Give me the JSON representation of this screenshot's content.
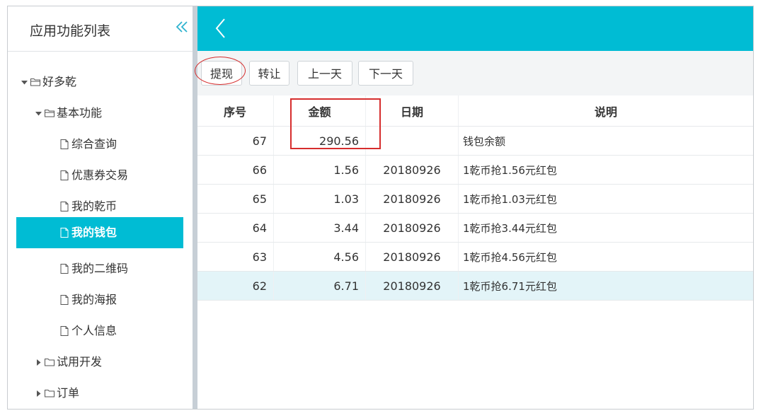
{
  "sidebar": {
    "title": "应用功能列表",
    "collapse_icon": "double-chevron-left-icon",
    "tree": [
      {
        "label": "好多乾",
        "level": 0,
        "type": "folder",
        "expanded": true
      },
      {
        "label": "基本功能",
        "level": 1,
        "type": "folder",
        "expanded": true
      },
      {
        "label": "综合查询",
        "level": 2,
        "type": "file"
      },
      {
        "label": "优惠券交易",
        "level": 2,
        "type": "file"
      },
      {
        "label": "我的乾币",
        "level": 2,
        "type": "file"
      },
      {
        "label": "我的钱包",
        "level": 2,
        "type": "file",
        "active": true
      },
      {
        "label": "我的二维码",
        "level": 2,
        "type": "file"
      },
      {
        "label": "我的海报",
        "level": 2,
        "type": "file"
      },
      {
        "label": "个人信息",
        "level": 2,
        "type": "file"
      },
      {
        "label": "试用开发",
        "level": 1,
        "type": "folder",
        "expanded": false
      },
      {
        "label": "订单",
        "level": 1,
        "type": "folder",
        "expanded": false
      }
    ]
  },
  "topbar": {
    "back_icon": "chevron-left-icon",
    "color": "#00bcd4"
  },
  "toolbar": {
    "withdraw": "提现",
    "transfer": "转让",
    "prev_day": "上一天",
    "next_day": "下一天"
  },
  "table": {
    "columns": [
      "序号",
      "金额",
      "日期",
      "说明"
    ],
    "rows": [
      {
        "no": "67",
        "amount": "290.56",
        "date": "",
        "desc": "钱包余额"
      },
      {
        "no": "66",
        "amount": "1.56",
        "date": "20180926",
        "desc": "1乾币抢1.56元红包"
      },
      {
        "no": "65",
        "amount": "1.03",
        "date": "20180926",
        "desc": "1乾币抢1.03元红包"
      },
      {
        "no": "64",
        "amount": "3.44",
        "date": "20180926",
        "desc": "1乾币抢3.44元红包"
      },
      {
        "no": "63",
        "amount": "4.56",
        "date": "20180926",
        "desc": "1乾币抢4.56元红包"
      },
      {
        "no": "62",
        "amount": "6.71",
        "date": "20180926",
        "desc": "1乾币抢6.71元红包",
        "selected": true
      }
    ]
  },
  "colors": {
    "accent": "#00bcd4",
    "annotation": "#d62d2d",
    "selected_row": "#e3f4f8"
  }
}
